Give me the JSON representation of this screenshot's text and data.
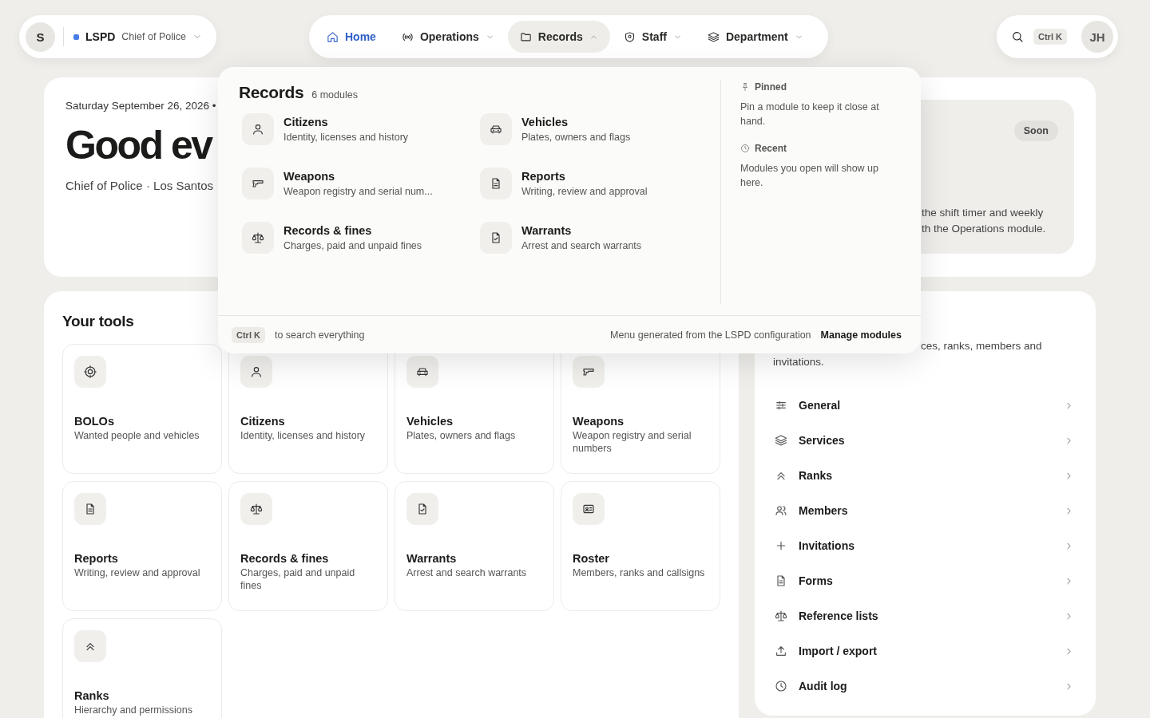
{
  "account": {
    "avatar": "S",
    "org": "LSPD",
    "role": "Chief of Police"
  },
  "nav": [
    {
      "label": "Home",
      "kind": "home",
      "selected": true,
      "has_menu": false,
      "expanded": false
    },
    {
      "label": "Operations",
      "kind": "radio",
      "selected": false,
      "has_menu": true,
      "expanded": false
    },
    {
      "label": "Records",
      "kind": "folder",
      "selected": false,
      "has_menu": true,
      "expanded": true
    },
    {
      "label": "Staff",
      "kind": "shield",
      "selected": false,
      "has_menu": true,
      "expanded": false
    },
    {
      "label": "Department",
      "kind": "layers",
      "selected": false,
      "has_menu": true,
      "expanded": false
    }
  ],
  "search": {
    "shortcut": "Ctrl K"
  },
  "user": {
    "initials": "JH"
  },
  "hero": {
    "date": "Saturday September 26, 2026 •",
    "greeting": "Good ev",
    "subtitle": "Chief of Police · Los Santos",
    "badge": "Soon",
    "note_lines": [
      "the shift timer and weekly",
      "th the Operations module."
    ]
  },
  "tools": {
    "title": "Your tools",
    "items": [
      {
        "title": "BOLOs",
        "description": "Wanted people and vehicles",
        "kind": "target"
      },
      {
        "title": "Citizens",
        "description": "Identity, licenses and history",
        "kind": "person"
      },
      {
        "title": "Vehicles",
        "description": "Plates, owners and flags",
        "kind": "car"
      },
      {
        "title": "Weapons",
        "description": "Weapon registry and serial numbers",
        "kind": "pistol"
      },
      {
        "title": "Reports",
        "description": "Writing, review and approval",
        "kind": "document"
      },
      {
        "title": "Records & fines",
        "description": "Charges, paid and unpaid fines",
        "kind": "scale"
      },
      {
        "title": "Warrants",
        "description": "Arrest and search warrants",
        "kind": "warrant"
      },
      {
        "title": "Roster",
        "description": "Members, ranks and callsigns",
        "kind": "idcard"
      },
      {
        "title": "Ranks",
        "description": "Hierarchy and permissions",
        "kind": "chevrons"
      }
    ]
  },
  "settings": {
    "description_lines": [
      "ces, ranks, members and",
      "invitations."
    ],
    "items": [
      {
        "label": "General",
        "kind": "sliders"
      },
      {
        "label": "Services",
        "kind": "layers"
      },
      {
        "label": "Ranks",
        "kind": "chevrons"
      },
      {
        "label": "Members",
        "kind": "users"
      },
      {
        "label": "Invitations",
        "kind": "plus"
      },
      {
        "label": "Forms",
        "kind": "document"
      },
      {
        "label": "Reference lists",
        "kind": "scale"
      },
      {
        "label": "Import / export",
        "kind": "upload"
      },
      {
        "label": "Audit log",
        "kind": "clock"
      }
    ]
  },
  "menu": {
    "title": "Records",
    "count": "6 modules",
    "items": [
      {
        "title": "Citizens",
        "description": "Identity, licenses and history",
        "kind": "person"
      },
      {
        "title": "Vehicles",
        "description": "Plates, owners and flags",
        "kind": "car"
      },
      {
        "title": "Weapons",
        "description": "Weapon registry and serial num...",
        "kind": "pistol"
      },
      {
        "title": "Reports",
        "description": "Writing, review and approval",
        "kind": "document"
      },
      {
        "title": "Records & fines",
        "description": "Charges, paid and unpaid fines",
        "kind": "scale"
      },
      {
        "title": "Warrants",
        "description": "Arrest and search warrants",
        "kind": "warrant"
      }
    ],
    "pinned": {
      "title": "Pinned",
      "text": "Pin a module to keep it close at hand."
    },
    "recent": {
      "title": "Recent",
      "text": "Modules you open will show up here."
    },
    "footer": {
      "shortcut": "Ctrl K",
      "hint": "to search everything",
      "note": "Menu generated from the LSPD configuration",
      "action": "Manage modules"
    }
  }
}
